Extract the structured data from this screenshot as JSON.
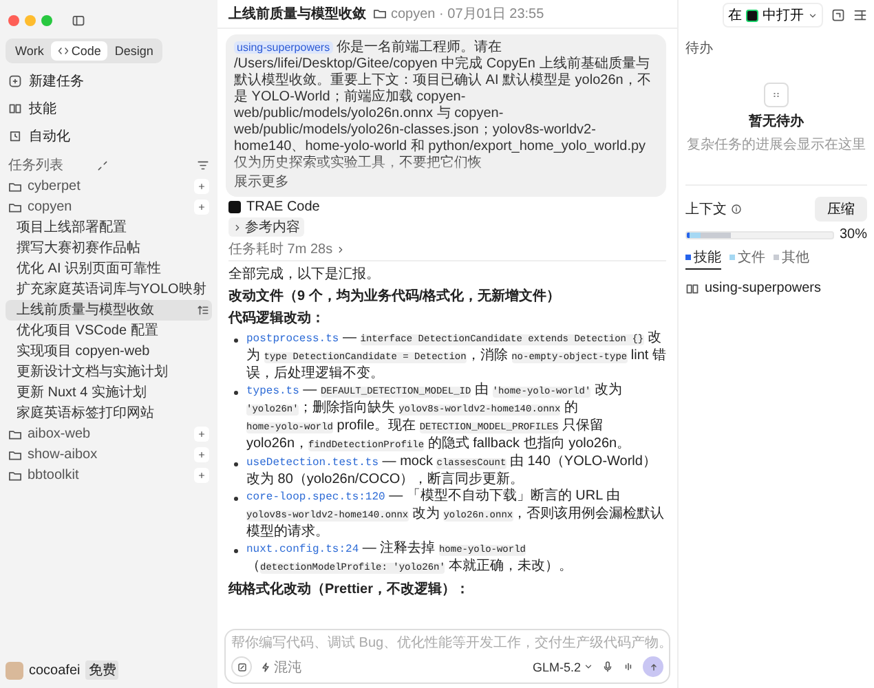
{
  "sidebar": {
    "mode_tabs": [
      {
        "label": "Work",
        "selected": false
      },
      {
        "label": "Code",
        "selected": true
      },
      {
        "label": "Design",
        "selected": false
      }
    ],
    "nav": [
      {
        "label": "新建任务",
        "kind": "new"
      },
      {
        "label": "技能",
        "kind": "skills"
      },
      {
        "label": "自动化",
        "kind": "auto"
      }
    ],
    "section_title": "任务列表",
    "projects": [
      {
        "name": "cyberpet"
      },
      {
        "name": "copyen",
        "children": [
          {
            "label": "项目上线部署配置",
            "selected": false
          },
          {
            "label": "撰写大赛初赛作品帖",
            "selected": false
          },
          {
            "label": "优化 AI 识别页面可靠性",
            "selected": false
          },
          {
            "label": "扩充家庭英语词库与YOLO映射",
            "selected": false
          },
          {
            "label": "上线前质量与模型收敛",
            "selected": true
          },
          {
            "label": "优化项目 VSCode 配置",
            "selected": false
          },
          {
            "label": "实现项目 copyen-web",
            "selected": false
          },
          {
            "label": "更新设计文档与实施计划",
            "selected": false
          },
          {
            "label": "更新 Nuxt 4 实施计划",
            "selected": false
          },
          {
            "label": "家庭英语标签打印网站",
            "selected": false
          }
        ]
      },
      {
        "name": "aibox-web"
      },
      {
        "name": "show-aibox"
      },
      {
        "name": "bbtoolkit"
      }
    ],
    "user": {
      "name": "cocoafei",
      "badge": "免费"
    }
  },
  "main": {
    "title": "上线前质量与模型收敛",
    "meta": "copyen · 07月01日 23:55",
    "message": {
      "skill": "using-superpowers",
      "text": "你是一名前端工程师。请在 /Users/lifei/Desktop/Gitee/copyen 中完成 CopyEn 上线前基础质量与默认模型收敛。重要上下文：项目已确认 AI 默认模型是 yolo26n，不是 YOLO-World；前端应加载 copyen-web/public/models/yolo26n.onnx 与 copyen-web/public/models/yolo26n-classes.json；yolov8s-worldv2-home140、home-yolo-world 和 python/export_home_yolo_world.py 仅为历史探索或实验工具，不要把它们恢",
      "more": "展示更多"
    },
    "agent": "TRAE Code",
    "reference": "参考内容",
    "duration": "任务耗时 7m 28s",
    "summary": "全部完成，以下是汇报。",
    "heading": "改动文件（9 个，均为业务代码/格式化，无新增文件）",
    "subheading": "代码逻辑改动：",
    "bullets": [
      [
        {
          "kind": "link",
          "text": "postprocess.ts"
        },
        {
          "kind": "text",
          "text": " — "
        },
        {
          "kind": "code",
          "text": "interface DetectionCandidate extends Detection {}"
        },
        {
          "kind": "text",
          "text": " 改为 "
        },
        {
          "kind": "code",
          "text": "type DetectionCandidate = Detection"
        },
        {
          "kind": "text",
          "text": "，消除 "
        },
        {
          "kind": "code",
          "text": "no-empty-object-type"
        },
        {
          "kind": "text",
          "text": " lint 错误，后处理逻辑不变。"
        }
      ],
      [
        {
          "kind": "link",
          "text": "types.ts"
        },
        {
          "kind": "text",
          "text": " — "
        },
        {
          "kind": "code",
          "text": "DEFAULT_DETECTION_MODEL_ID"
        },
        {
          "kind": "text",
          "text": " 由 "
        },
        {
          "kind": "code",
          "text": "'home-yolo-world'"
        },
        {
          "kind": "text",
          "text": " 改为 "
        },
        {
          "kind": "code",
          "text": "'yolo26n'"
        },
        {
          "kind": "text",
          "text": "；删除指向缺失 "
        },
        {
          "kind": "code",
          "text": "yolov8s-worldv2-home140.onnx"
        },
        {
          "kind": "text",
          "text": " 的 "
        },
        {
          "kind": "code",
          "text": "home-yolo-world"
        },
        {
          "kind": "text",
          "text": " profile。现在 "
        },
        {
          "kind": "code",
          "text": "DETECTION_MODEL_PROFILES"
        },
        {
          "kind": "text",
          "text": " 只保留 yolo26n，"
        },
        {
          "kind": "code",
          "text": "findDetectionProfile"
        },
        {
          "kind": "text",
          "text": " 的隐式 fallback 也指向 yolo26n。"
        }
      ],
      [
        {
          "kind": "link",
          "text": "useDetection.test.ts"
        },
        {
          "kind": "text",
          "text": " — mock "
        },
        {
          "kind": "code",
          "text": "classesCount"
        },
        {
          "kind": "text",
          "text": " 由 140（YOLO-World）改为 80（yolo26n/COCO），断言同步更新。"
        }
      ],
      [
        {
          "kind": "link",
          "text": "core-loop.spec.ts:120"
        },
        {
          "kind": "text",
          "text": " — 「模型不自动下载」断言的 URL 由 "
        },
        {
          "kind": "code",
          "text": "yolov8s-worldv2-home140.onnx"
        },
        {
          "kind": "text",
          "text": " 改为 "
        },
        {
          "kind": "code",
          "text": "yolo26n.onnx"
        },
        {
          "kind": "text",
          "text": "，否则该用例会漏检默认模型的请求。"
        }
      ],
      [
        {
          "kind": "link",
          "text": "nuxt.config.ts:24"
        },
        {
          "kind": "text",
          "text": " — 注释去掉 "
        },
        {
          "kind": "code",
          "text": "home-yolo-world"
        },
        {
          "kind": "text",
          "text": "（"
        },
        {
          "kind": "code",
          "text": "detectionModelProfile: 'yolo26n'"
        },
        {
          "kind": "text",
          "text": " 本就正确，未改）。"
        }
      ]
    ],
    "trailing": "纯格式化改动（Prettier，不改逻辑）：",
    "input": {
      "placeholder": "帮你编写代码、调试 Bug、优化性能等开发工作，交付生产级代码产物。",
      "mode": "混沌",
      "model": "GLM-5.2"
    }
  },
  "right": {
    "open_prefix": "在",
    "open_suffix": "中打开",
    "todo_title": "待办",
    "empty_title": "暂无待办",
    "empty_hint": "复杂任务的进展会显示在这里",
    "context_label": "上下文",
    "compress": "压缩",
    "percent": "30%",
    "meter_segments": [
      {
        "color": "#2563eb",
        "level": 0.02
      },
      {
        "color": "#a5d8f3",
        "level": 0.07
      },
      {
        "color": "#c9ccd3",
        "level": 0.21
      }
    ],
    "legend": [
      {
        "label": "技能",
        "color": "#2563eb",
        "selected": true
      },
      {
        "label": "文件",
        "color": "#a5d8f3",
        "selected": false
      },
      {
        "label": "其他",
        "color": "#c9ccd3",
        "selected": false
      }
    ],
    "skills": [
      "using-superpowers"
    ]
  }
}
